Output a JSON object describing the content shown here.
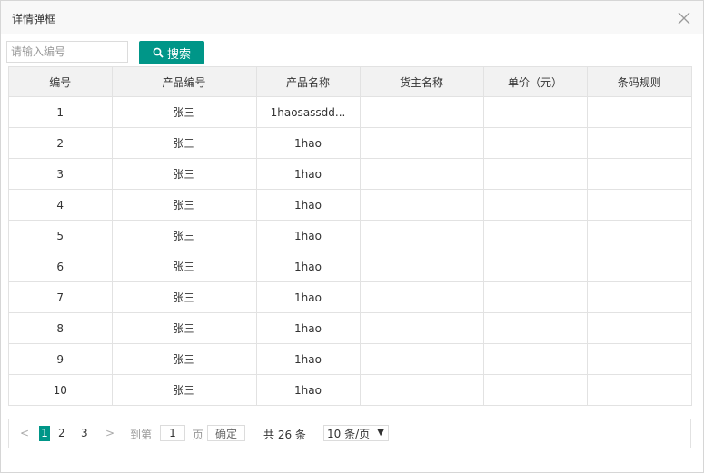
{
  "dialog": {
    "title": "详情弹框",
    "close_icon": "close-icon"
  },
  "search": {
    "placeholder": "请输入编号",
    "value": "",
    "button_label": "搜索",
    "icon": "search-icon",
    "button_color": "#009688"
  },
  "table": {
    "columns": [
      "编号",
      "产品编号",
      "产品名称",
      "货主名称",
      "单价（元）",
      "条码规则"
    ],
    "rows": [
      [
        "1",
        "张三",
        "1haosassdd...",
        "",
        "",
        ""
      ],
      [
        "2",
        "张三",
        "1hao",
        "",
        "",
        ""
      ],
      [
        "3",
        "张三",
        "1hao",
        "",
        "",
        ""
      ],
      [
        "4",
        "张三",
        "1hao",
        "",
        "",
        ""
      ],
      [
        "5",
        "张三",
        "1hao",
        "",
        "",
        ""
      ],
      [
        "6",
        "张三",
        "1hao",
        "",
        "",
        ""
      ],
      [
        "7",
        "张三",
        "1hao",
        "",
        "",
        ""
      ],
      [
        "8",
        "张三",
        "1hao",
        "",
        "",
        ""
      ],
      [
        "9",
        "张三",
        "1hao",
        "",
        "",
        ""
      ],
      [
        "10",
        "张三",
        "1hao",
        "",
        "",
        ""
      ]
    ]
  },
  "pagination": {
    "prev": "<",
    "pages": [
      "1",
      "2",
      "3"
    ],
    "current": "1",
    "next": ">",
    "goto_label": "到第",
    "goto_value": "1",
    "page_unit": "页",
    "confirm_label": "确定",
    "total_label": "共 26 条",
    "page_size": "10 条/页",
    "accent": "#009688"
  }
}
